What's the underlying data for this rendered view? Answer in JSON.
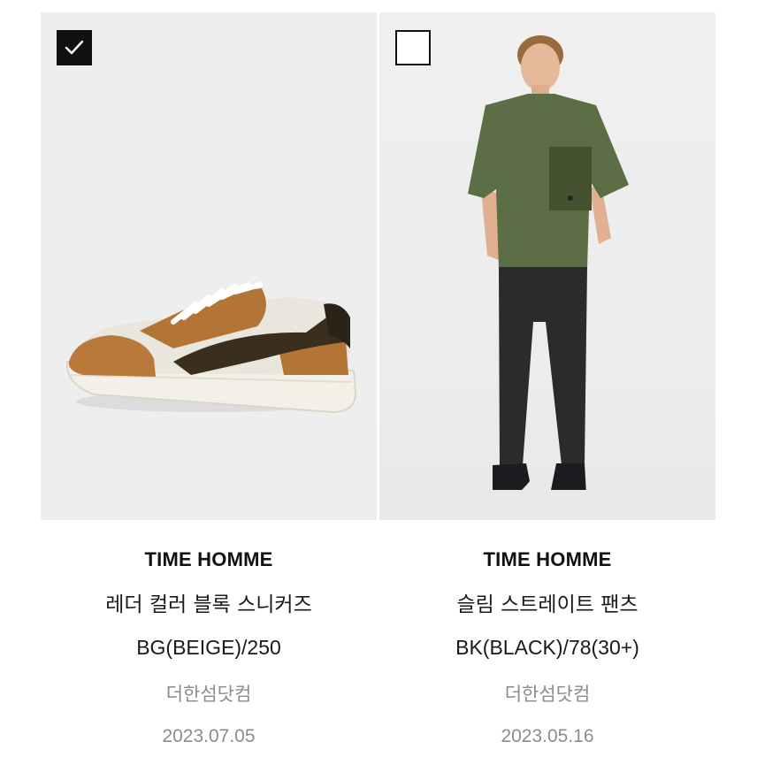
{
  "products": [
    {
      "selected": true,
      "image": "sneaker-photo",
      "brand": "TIME HOMME",
      "name": "레더 컬러 블록 스니커즈",
      "option": "BG(BEIGE)/250",
      "seller": "더한섬닷컴",
      "date": "2023.07.05"
    },
    {
      "selected": false,
      "image": "model-photo",
      "brand": "TIME HOMME",
      "name": "슬림 스트레이트 팬츠",
      "option": "BK(BLACK)/78(30+)",
      "seller": "더한섬닷컴",
      "date": "2023.05.16"
    }
  ],
  "colors": {
    "checkbox": "#111111",
    "meta_text": "#8c8c8c",
    "image_bg": "#eeeeee"
  }
}
